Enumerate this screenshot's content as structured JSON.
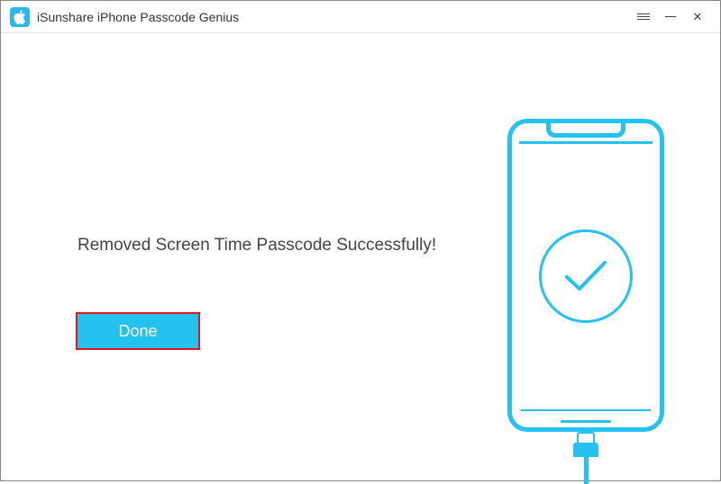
{
  "titlebar": {
    "app_title": "iSunshare iPhone Passcode Genius"
  },
  "content": {
    "success_message": "Removed Screen Time Passcode Successfully!",
    "done_button_label": "Done"
  },
  "colors": {
    "accent": "#25c1f1",
    "highlight_outline": "#e21818"
  }
}
